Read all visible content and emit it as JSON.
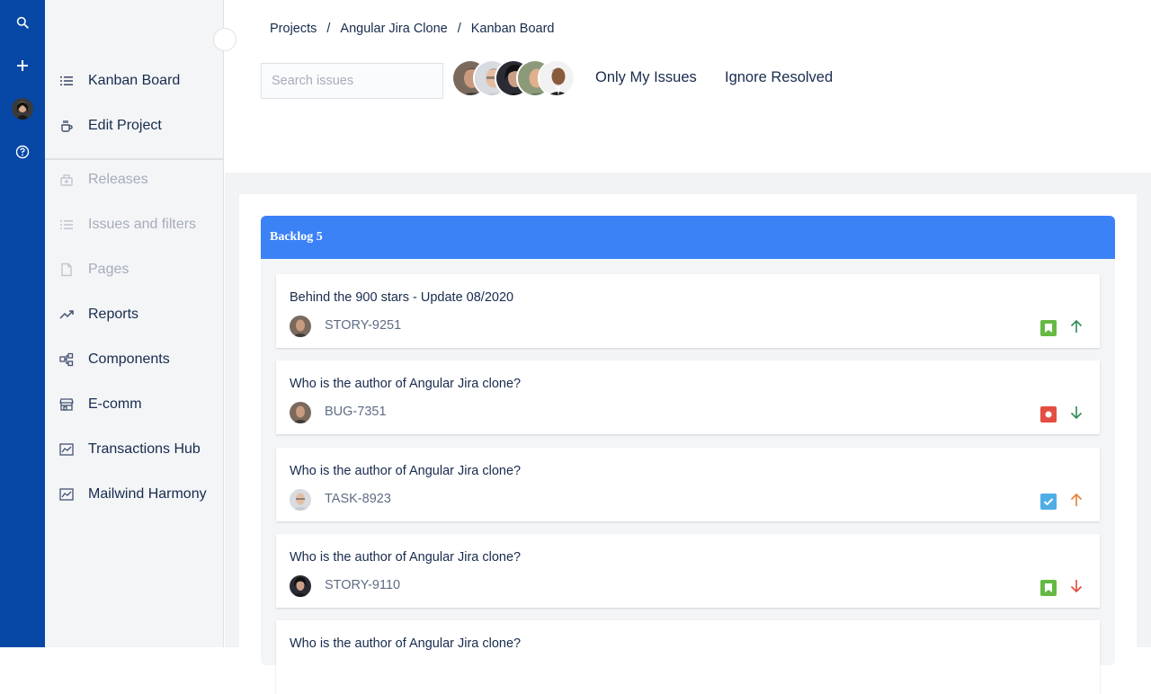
{
  "breadcrumb": [
    "Projects",
    "Angular Jira Clone",
    "Kanban Board"
  ],
  "sidebar": {
    "items": [
      {
        "label": "Kanban Board",
        "icon": "board-list-icon",
        "disabled": false
      },
      {
        "label": "Edit Project",
        "icon": "settings-cup-icon",
        "disabled": false
      },
      {
        "label": "Releases",
        "icon": "releases-icon",
        "disabled": true
      },
      {
        "label": "Issues and filters",
        "icon": "issues-list-icon",
        "disabled": true
      },
      {
        "label": "Pages",
        "icon": "page-icon",
        "disabled": true
      },
      {
        "label": "Reports",
        "icon": "trend-icon",
        "disabled": false
      },
      {
        "label": "Components",
        "icon": "components-icon",
        "disabled": false
      },
      {
        "label": "E-comm",
        "icon": "store-icon",
        "disabled": false
      },
      {
        "label": "Transactions Hub",
        "icon": "chart-icon",
        "disabled": false
      },
      {
        "label": "Mailwind Harmony",
        "icon": "chart-icon",
        "disabled": false
      }
    ]
  },
  "rail": {
    "icons": [
      "search-icon",
      "plus-icon",
      "user-avatar",
      "help-icon"
    ]
  },
  "search": {
    "placeholder": "Search issues",
    "value": ""
  },
  "filters": {
    "only_my_issues": "Only My Issues",
    "ignore_resolved": "Ignore Resolved"
  },
  "column": {
    "title": "Backlog 5",
    "color": "#3b82f6"
  },
  "issues": [
    {
      "title": "Behind the 900 stars - Update 08/2020",
      "key": "STORY-9251",
      "type": "story",
      "priority": "high"
    },
    {
      "title": "Who is the author of Angular Jira clone?",
      "key": "BUG-7351",
      "type": "bug",
      "priority": "low"
    },
    {
      "title": "Who is the author of Angular Jira clone?",
      "key": "TASK-8923",
      "type": "task",
      "priority": "medium"
    },
    {
      "title": "Who is the author of Angular Jira clone?",
      "key": "STORY-9110",
      "type": "story",
      "priority": "lowest"
    },
    {
      "title": "Who is the author of Angular Jira clone?",
      "key": "",
      "type": "",
      "priority": ""
    }
  ],
  "colors": {
    "rail": "#0747a6",
    "story": "#65ba43",
    "bug": "#e44d42",
    "task": "#4fade6",
    "priority_high": "#2e8b57",
    "priority_medium": "#e97f33",
    "priority_lowest": "#e5493a"
  }
}
